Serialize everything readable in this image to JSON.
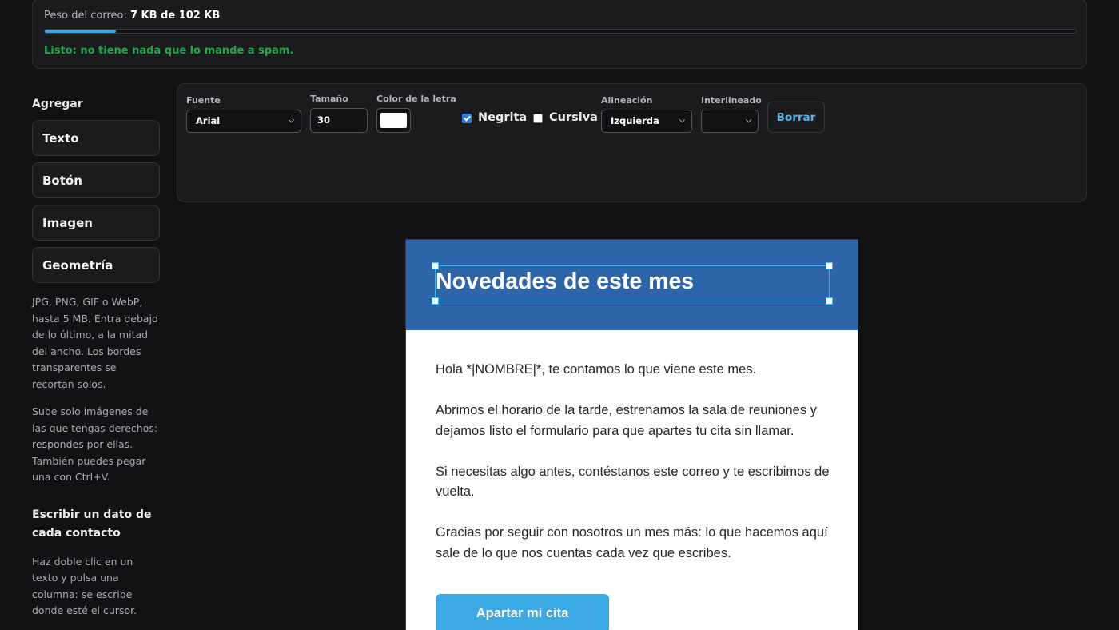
{
  "weight": {
    "label_prefix": "Peso del correo: ",
    "value": "7 KB de 102 KB",
    "progress_fraction": 0.069,
    "status": "Listo: no tiene nada que lo mande a spam."
  },
  "sidebar": {
    "heading": "Agregar",
    "buttons": [
      "Texto",
      "Botón",
      "Imagen",
      "Geometría"
    ],
    "image_help": "JPG, PNG, GIF o WebP, hasta 5 MB. Entra debajo de lo último, a la mitad del ancho. Los bordes transparentes se recortan solos.",
    "rights_help": "Sube solo imágenes de las que tengas derechos: respondes por ellas. También puedes pegar una con Ctrl+V.",
    "merge_heading": "Escribir un dato de cada contacto",
    "merge_help": "Haz doble clic en un texto y pulsa una columna: se escribe donde esté el cursor."
  },
  "toolbar": {
    "font_label": "Fuente",
    "font_value": "Arial",
    "size_label": "Tamaño",
    "size_value": "30",
    "color_label": "Color de la letra",
    "color_value": "#ffffff",
    "bold_label": "Negrita",
    "bold_checked": true,
    "italic_label": "Cursiva",
    "italic_checked": false,
    "align_label": "Alineación",
    "align_value": "Izquierda",
    "line_height_label": "Interlineado",
    "line_height_value": "",
    "erase_label": "Borrar"
  },
  "email": {
    "header_color": "#2e64a8",
    "title": "Novedades de este mes",
    "paragraphs": [
      "Hola *|NOMBRE|*, te contamos lo que viene este mes.",
      "Abrimos el horario de la tarde, estrenamos la sala de reuniones y dejamos listo el formulario para que apartes tu cita sin llamar.",
      "Si necesitas algo antes, contéstanos este correo y te escribimos de vuelta.",
      "Gracias por seguir con nosotros un mes más: lo que hacemos aquí sale de lo que nos cuentas cada vez que escribes."
    ],
    "cta_label": "Apartar mi cita"
  },
  "colors": {
    "accent": "#3aa3e0",
    "ok": "#22a64a",
    "selection": "#43b3f2"
  }
}
